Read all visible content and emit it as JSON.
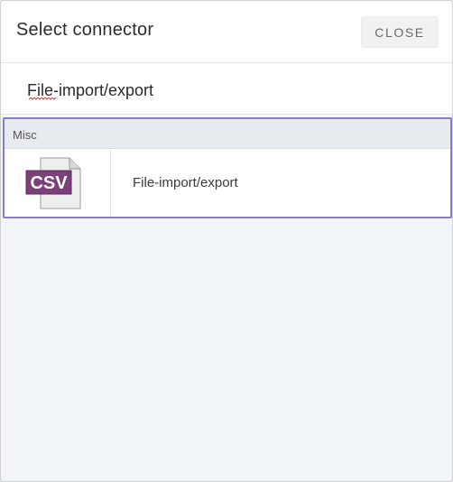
{
  "dialog": {
    "title": "Select connector",
    "close_label": "CLOSE"
  },
  "search": {
    "value": "File-import/export"
  },
  "groups": [
    {
      "label": "Misc",
      "items": [
        {
          "label": "File-import/export",
          "icon": "csv-file-icon",
          "icon_text": "CSV"
        }
      ]
    }
  ],
  "colors": {
    "accent": "#8a7cc9",
    "csv_badge": "#7b3f7a",
    "content_bg": "#f1f4f8"
  }
}
